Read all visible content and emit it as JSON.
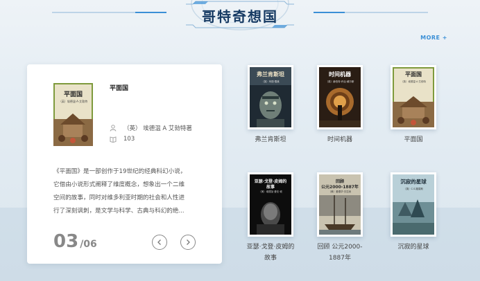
{
  "section": {
    "title": "哥特奇想国",
    "more_label": "MORE +"
  },
  "featured": {
    "cover_title": "平面国",
    "cover_author": "（英）埃德温·A·艾勃特",
    "title": "平面国",
    "author": "（英） 埃德温 A 艾勃特著",
    "count": "103",
    "description_lines": [
      "《平面国》是一部创作于19世纪的经典科幻小说，",
      "它借由小说形式阐释了维度概念，想象出一个二维",
      "空间的故事，同时对维多利亚时期的社会和人性进",
      "行了深刻讽刺，是文学与科学、古典与科幻的绝..."
    ],
    "page_current": "03",
    "page_total": "/06"
  },
  "books": [
    {
      "name": "弗兰肯斯坦",
      "cover_title": "弗兰肯斯坦",
      "cover_author": "（英）玛丽·雪莱"
    },
    {
      "name": "时间机器",
      "cover_title": "时间机器",
      "cover_author": "（英）赫伯特·乔治·威尔斯"
    },
    {
      "name": "平面国",
      "cover_title": "平面国",
      "cover_author": "（英）埃德温·A·艾勃特"
    },
    {
      "name_line1": "亚瑟·戈登·皮姆的",
      "name_line2": "故事",
      "cover_title_line1": "亚瑟·戈登·皮姆的",
      "cover_title_line2": "故事",
      "cover_author": "（美）埃德加·爱伦·坡"
    },
    {
      "name_line1": "回顾 公元2000-",
      "name_line2": "1887年",
      "cover_title_line1": "回顾",
      "cover_title_line2": "公元2000-1887年",
      "cover_author": "（美）爱德华·贝拉米"
    },
    {
      "name": "沉寂的星球",
      "cover_title": "沉寂的星球",
      "cover_author": "（英）C.S.路易斯"
    }
  ],
  "icons": {
    "author": "person-icon",
    "count": "book-icon",
    "prev": "chevron-left-icon",
    "next": "chevron-right-icon"
  }
}
